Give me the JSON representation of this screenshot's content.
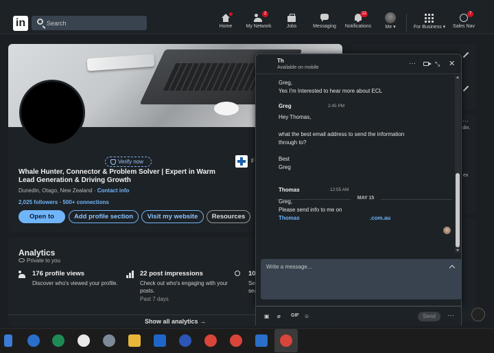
{
  "nav": {
    "logo": "in",
    "search_placeholder": "Search",
    "items": [
      {
        "label": "Home",
        "icon": "home-icon",
        "badge": ""
      },
      {
        "label": "My Network",
        "icon": "network-icon",
        "badge": "2"
      },
      {
        "label": "Jobs",
        "icon": "jobs-icon",
        "badge": ""
      },
      {
        "label": "Messaging",
        "icon": "messaging-icon",
        "badge": ""
      },
      {
        "label": "Notifications",
        "icon": "bell-icon",
        "badge": "12"
      },
      {
        "label": "Me ▾",
        "icon": "avatar",
        "badge": ""
      },
      {
        "label": "For Business ▾",
        "icon": "grid-icon",
        "badge": ""
      },
      {
        "label": "Sales Nav",
        "icon": "compass-icon",
        "badge": "7"
      }
    ]
  },
  "profile": {
    "verify_label": "Verify now",
    "headline": "Whale Hunter, Connector & Problem Solver | Expert in Warm Lead Generation & Driving Growth",
    "location": "Dunedin, Otago, New Zealand · ",
    "contact_info": "Contact info",
    "followers": "2,025 followers",
    "connections": " · 500+ connections",
    "company_name": "F",
    "buttons": {
      "open_to": "Open to",
      "add_section": "Add profile section",
      "visit_website": "Visit my website",
      "resources": "Resources"
    }
  },
  "analytics": {
    "title": "Analytics",
    "subtitle": "Private to you",
    "stats": [
      {
        "title": "176 profile views",
        "desc": "Discover who's viewed your profile.",
        "meta": ""
      },
      {
        "title": "22 post impressions",
        "desc": "Check out who's engaging with your posts.",
        "meta": "Past 7 days"
      },
      {
        "title": "10",
        "desc": "Se sea",
        "meta": ""
      }
    ],
    "show_all": "Show all analytics →"
  },
  "right_column": {
    "text_a": "din.",
    "text_b": "ex"
  },
  "chat": {
    "name": "Th",
    "status": "Available on mobile",
    "messages": {
      "m1_line1": "Greg,",
      "m1_line2": "Yes I'm Interested to hear more about ECL",
      "sender_greg": "Greg",
      "time_greg": "2:45 PM",
      "m2_line1": "Hey Thomas,",
      "m2_line2": "what the best email address to send the information",
      "m2_line3": "through to?",
      "m2_line4": "Best",
      "m2_line5": "Greg",
      "day_separator": "MAY 15",
      "sender_thomas": "Thomas",
      "time_thomas": "· 12:55 AM",
      "m3_line1": "Greg,",
      "m3_line2": "Please send info to me on",
      "m3_email_start": "Thomas",
      "m3_email_end": ".com.au"
    },
    "compose_placeholder": "Write a message...",
    "footer": {
      "gif_label": "GIF",
      "send_label": "Send"
    }
  },
  "colors": {
    "accent": "#70b5f9",
    "badge": "#d11124",
    "background": "#1b1f23",
    "card": "#1d2226"
  }
}
